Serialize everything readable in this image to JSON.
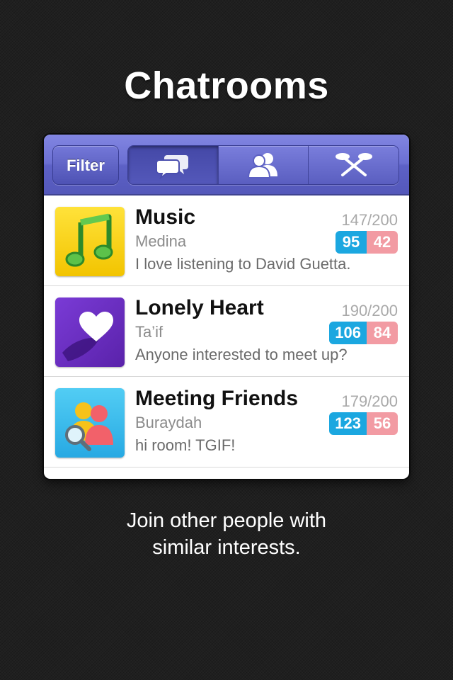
{
  "headline": "Chatrooms",
  "toolbar": {
    "filter_label": "Filter",
    "segments": [
      {
        "icon": "chat-bubbles-icon",
        "active": true
      },
      {
        "icon": "people-icon",
        "active": false
      },
      {
        "icon": "gender-symbols-icon",
        "active": false
      }
    ]
  },
  "rooms": [
    {
      "name": "Music",
      "count": "147/200",
      "city": "Medina",
      "males": "95",
      "females": "42",
      "message": "I love listening to David Guetta.",
      "icon": "music-note-icon",
      "color": "#f6d400"
    },
    {
      "name": "Lonely Heart",
      "count": "190/200",
      "city": "Ta’if",
      "males": "106",
      "females": "84",
      "message": "Anyone interested to meet up?",
      "icon": "heart-icon",
      "color": "#6b2fc2"
    },
    {
      "name": "Meeting Friends",
      "count": "179/200",
      "city": "Buraydah",
      "males": "123",
      "females": "56",
      "message": "hi room! TGIF!",
      "icon": "friends-search-icon",
      "color": "#3cc0ef"
    }
  ],
  "footer": {
    "line1": "Join other people with",
    "line2": "similar interests."
  },
  "colors": {
    "toolbar": "#6b6fd2",
    "male_badge": "#1ba7e0",
    "female_badge": "#f29ba3"
  }
}
